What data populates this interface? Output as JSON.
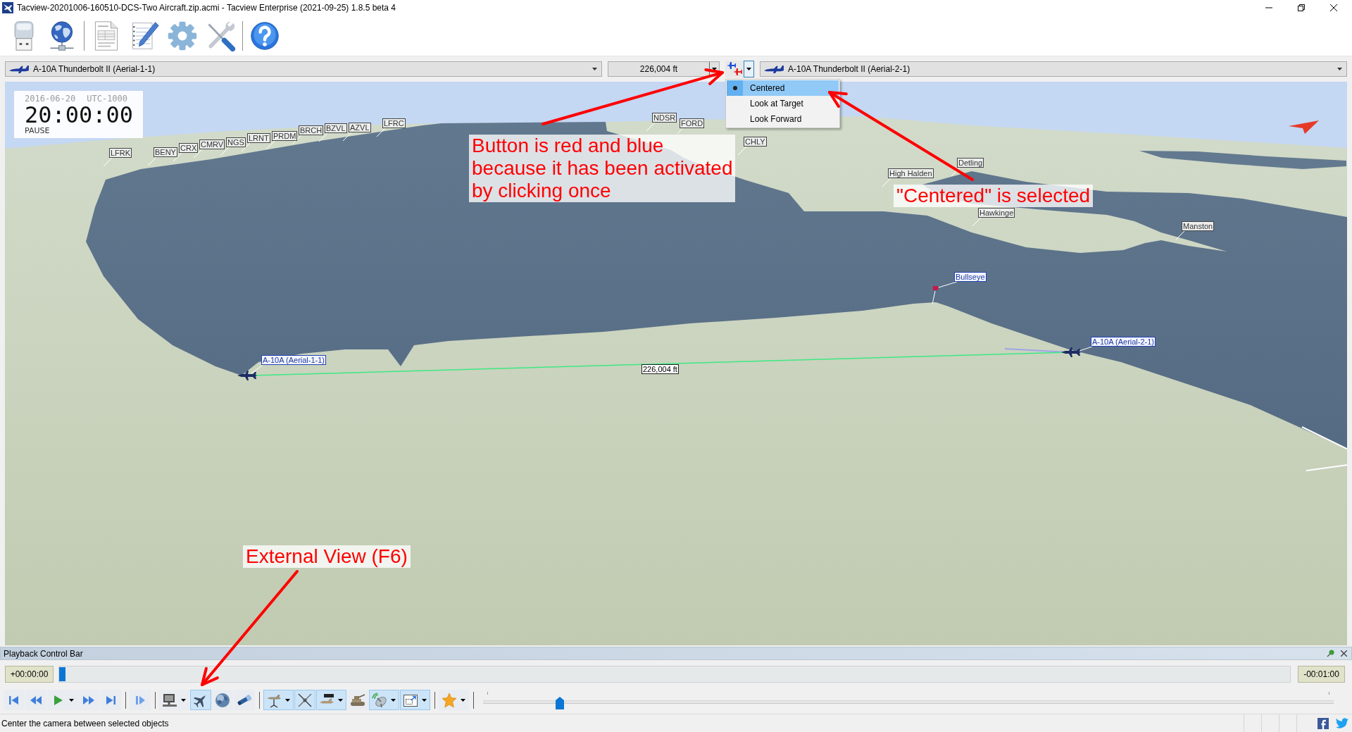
{
  "window": {
    "title": "Tacview-20201006-160510-DCS-Two Aircraft.zip.acmi - Tacview Enterprise (2021-09-25) 1.8.5 beta 4"
  },
  "object_bar": {
    "primary_object": "A-10A Thunderbolt II (Aerial-1-1)",
    "distance": "226,004 ft",
    "camera_button": {
      "active": true,
      "menu_open": true,
      "menu_items": [
        {
          "label": "Centered",
          "selected": true
        },
        {
          "label": "Look at Target",
          "selected": false
        },
        {
          "label": "Look Forward",
          "selected": false
        }
      ]
    },
    "secondary_object": "A-10A Thunderbolt II (Aerial-2-1)"
  },
  "view": {
    "date": "2016-06-20",
    "timezone": "UTC-1000",
    "clock": "20:00:00",
    "status": "PAUSE",
    "labels": [
      {
        "text": "LFRK",
        "kind": "place"
      },
      {
        "text": "BENY",
        "kind": "place"
      },
      {
        "text": "CRX",
        "kind": "place"
      },
      {
        "text": "CMRV",
        "kind": "place"
      },
      {
        "text": "NGS",
        "kind": "place"
      },
      {
        "text": "LRNT",
        "kind": "place"
      },
      {
        "text": "PRDM",
        "kind": "place"
      },
      {
        "text": "BRCH",
        "kind": "place"
      },
      {
        "text": "BZVL",
        "kind": "place"
      },
      {
        "text": "AZVL",
        "kind": "place"
      },
      {
        "text": "LFRC",
        "kind": "place"
      },
      {
        "text": "NDSR",
        "kind": "place"
      },
      {
        "text": "FORD",
        "kind": "place"
      },
      {
        "text": "CHLY",
        "kind": "place"
      },
      {
        "text": "Detling",
        "kind": "place"
      },
      {
        "text": "High Halden",
        "kind": "place"
      },
      {
        "text": "Hawkinge",
        "kind": "place"
      },
      {
        "text": "Manston",
        "kind": "place"
      },
      {
        "text": "Bullseye",
        "kind": "object"
      },
      {
        "text": "A-10A (Aerial-1-1)",
        "kind": "object"
      },
      {
        "text": "226,004 ft",
        "kind": "distance"
      },
      {
        "text": "A-10A (Aerial-2-1)",
        "kind": "object"
      }
    ]
  },
  "annotations": [
    {
      "text": "Button is red and blue\nbecause it has been activated\nby clicking once"
    },
    {
      "text": "\"Centered\" is selected"
    },
    {
      "text": "External View (F6)"
    }
  ],
  "playback_bar": {
    "title": "Playback Control Bar",
    "elapsed": "+00:00:00",
    "timeline": {
      "level": 0
    },
    "remaining": "-00:01:00",
    "button_groups": [
      [
        {
          "kind": "first",
          "on": false,
          "menu": false
        },
        {
          "kind": "rewind",
          "on": false,
          "menu": false
        },
        {
          "kind": "play",
          "on": false,
          "menu": true
        },
        {
          "kind": "fast-forward",
          "on": false,
          "menu": false
        },
        {
          "kind": "last",
          "on": false,
          "menu": false
        }
      ],
      [
        {
          "kind": "step",
          "on": false,
          "menu": false
        }
      ],
      [
        {
          "kind": "camera",
          "on": false,
          "menu": true
        },
        {
          "kind": "external",
          "on": true,
          "menu": false
        },
        {
          "kind": "globe",
          "on": false,
          "menu": false
        },
        {
          "kind": "telescope",
          "on": false,
          "menu": false
        }
      ],
      [
        {
          "kind": "models",
          "on": true,
          "menu": true
        },
        {
          "kind": "weapons",
          "on": true,
          "menu": false
        },
        {
          "kind": "labels",
          "on": true,
          "menu": true
        },
        {
          "kind": "ground",
          "on": false,
          "menu": false
        },
        {
          "kind": "radar",
          "on": true,
          "menu": true
        },
        {
          "kind": "layout",
          "on": true,
          "menu": true
        }
      ],
      [
        {
          "kind": "favorites",
          "on": false,
          "menu": true
        }
      ]
    ],
    "speed": {
      "level": 0.09
    }
  },
  "status_bar": {
    "text": "Center the camera between selected objects"
  }
}
